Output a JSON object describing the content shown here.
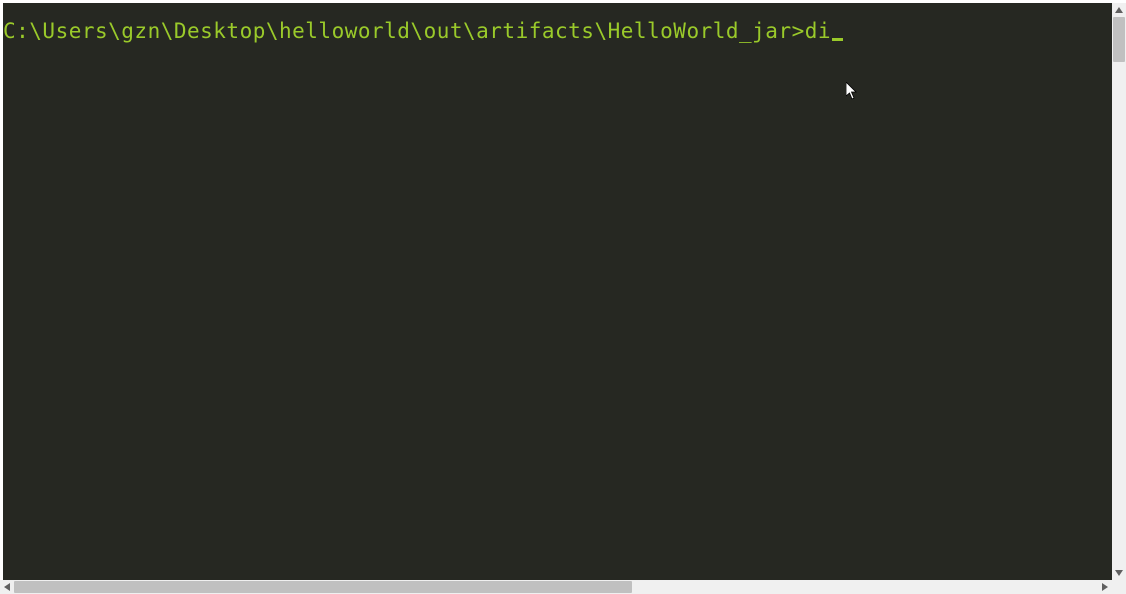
{
  "terminal": {
    "prompt": "C:\\Users\\gzn\\Desktop\\helloworld\\out\\artifacts\\HelloWorld_jar>",
    "command": "di",
    "text_color": "#9aca2a",
    "background_color": "#262822"
  }
}
